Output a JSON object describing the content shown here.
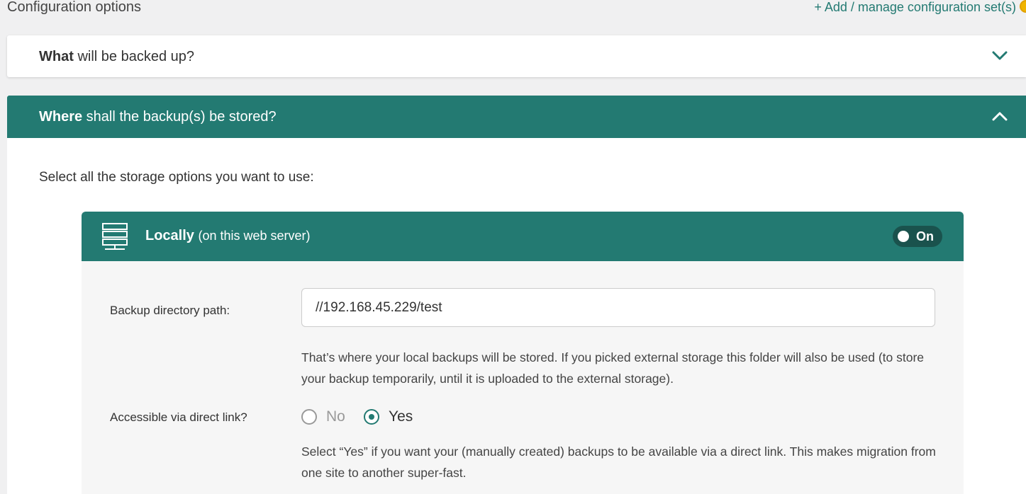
{
  "header": {
    "title": "Configuration options",
    "manage_link": "+ Add / manage configuration set(s)"
  },
  "what_panel": {
    "title_strong": "What",
    "title_rest": " will be backed up?",
    "expanded": false
  },
  "where_panel": {
    "title_strong": "Where",
    "title_rest": " shall the backup(s) be stored?",
    "expanded": true,
    "intro": "Select all the storage options you want to use:"
  },
  "local_storage": {
    "title": "Locally",
    "subtitle": "(on this web server)",
    "toggle_label": "On",
    "toggle_on": true,
    "directory_label": "Backup directory path:",
    "directory_value": "//192.168.45.229/test",
    "directory_help": "That’s where your local backups will be stored. If you picked external storage this folder will also be used (to store your backup temporarily, until it is uploaded to the external storage).",
    "direct_link_label": "Accessible via direct link?",
    "direct_link_options": [
      {
        "label": "No",
        "checked": false
      },
      {
        "label": "Yes",
        "checked": true
      }
    ],
    "direct_link_help": "Select “Yes” if you want your (manually created) backups to be available via a direct link. This makes migration from one site to another super-fast."
  },
  "colors": {
    "accent": "#237a72",
    "toggle_bg": "#1a524d",
    "background": "#f0f0f1"
  }
}
